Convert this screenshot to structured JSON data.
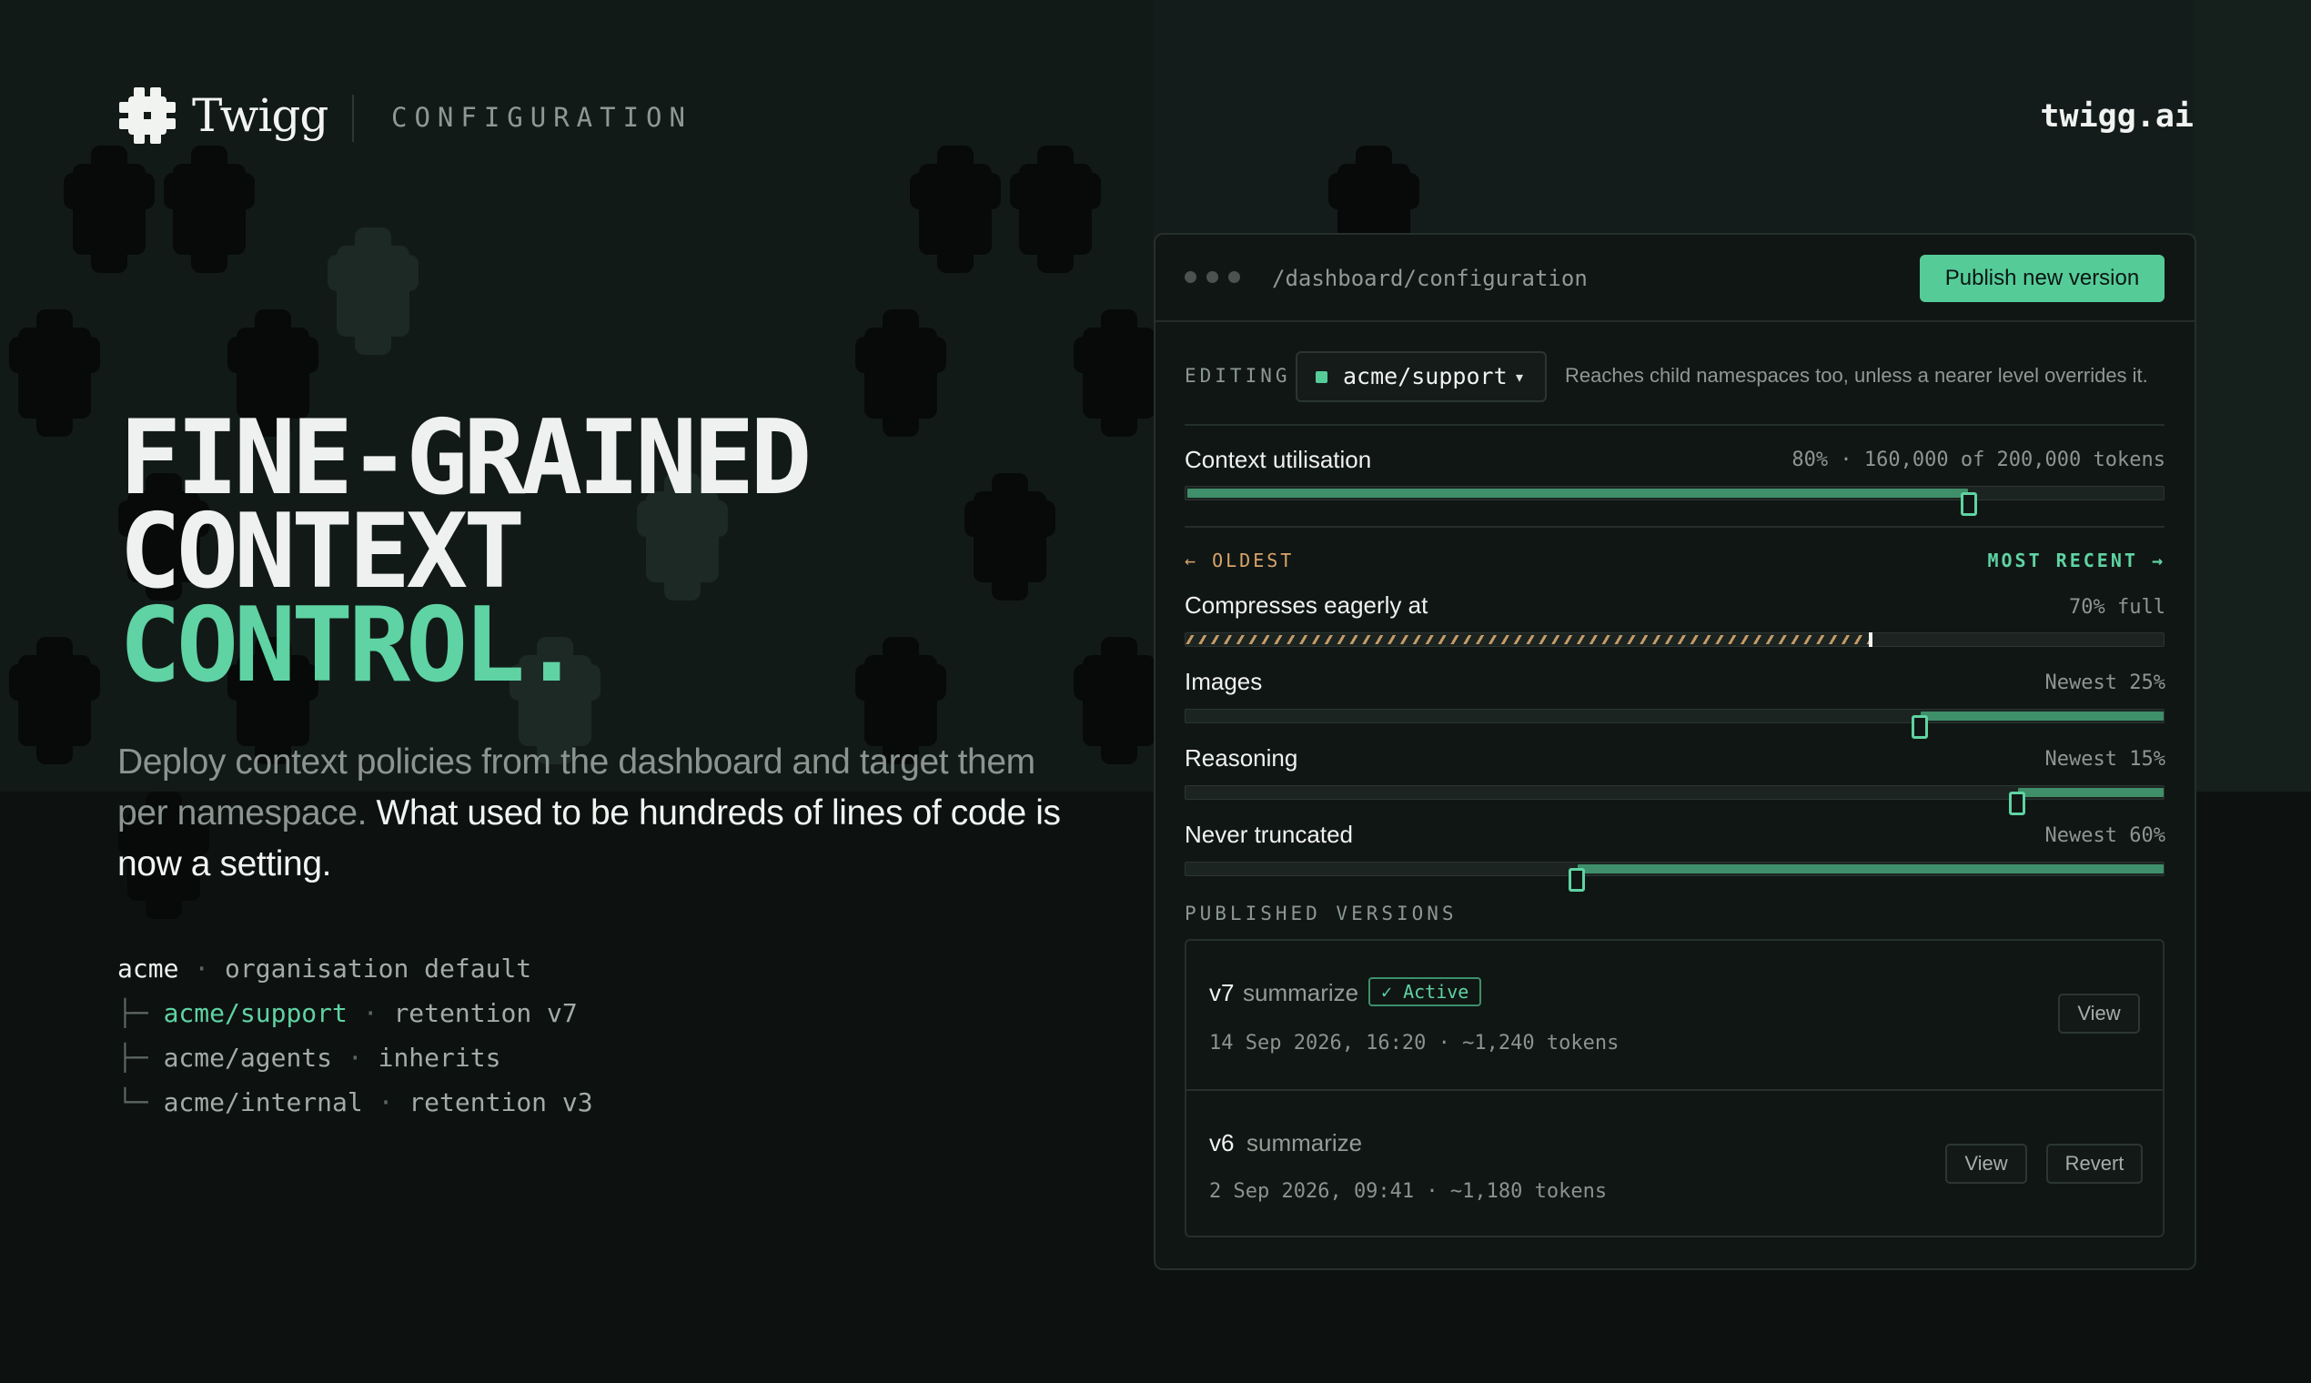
{
  "brand": {
    "name": "Twigg",
    "section": "CONFIGURATION",
    "domain": "twigg.ai"
  },
  "hero": {
    "line1": "FINE-GRAINED",
    "line2": "CONTEXT",
    "line3": "CONTROL.",
    "sub_muted": "Deploy context policies from the dashboard and target them per namespace.",
    "sub_strong": "What used to be hundreds of lines of code is now a setting."
  },
  "tree": [
    {
      "prefix": "",
      "name": "acme",
      "sep": " · ",
      "note": "organisation default"
    },
    {
      "prefix": "├─ ",
      "name": "acme/support",
      "sep": " · ",
      "note": "retention v7"
    },
    {
      "prefix": "├─ ",
      "name": "acme/agents",
      "sep": " · ",
      "note": "inherits"
    },
    {
      "prefix": "└─ ",
      "name": "acme/internal",
      "sep": " · ",
      "note": "retention v3"
    }
  ],
  "window": {
    "path": "/dashboard/configuration",
    "publish_label": "Publish new version",
    "editing_label": "EDITING",
    "namespace": "acme/support",
    "caret": "▾",
    "namespace_hint": "Reaches child namespaces too, unless a nearer level overrides it.",
    "context": {
      "label": "Context utilisation",
      "value_text": "80% · 160,000 of 200,000 tokens",
      "fraction": 0.8
    },
    "oldest_label": "← OLDEST",
    "recent_label": "MOST RECENT →",
    "compress": {
      "label": "Compresses eagerly at",
      "value_text": "70% full",
      "fraction": 0.7
    },
    "sliders": [
      {
        "label": "Images",
        "value_text": "Newest 25%",
        "fraction": 0.25
      },
      {
        "label": "Reasoning",
        "value_text": "Newest 15%",
        "fraction": 0.15
      },
      {
        "label": "Never truncated",
        "value_text": "Newest 60%",
        "fraction": 0.6
      }
    ],
    "versions_label": "PUBLISHED VERSIONS",
    "versions": [
      {
        "num": "v7",
        "name": "summarize",
        "badge": "✓ Active",
        "meta": "14 Sep 2026, 16:20 · ~1,240 tokens",
        "view": "View",
        "revert": ""
      },
      {
        "num": "v6",
        "name": "summarize",
        "badge": "",
        "meta": "2 Sep 2026, 09:41 · ~1,180 tokens",
        "view": "View",
        "revert": "Revert"
      }
    ]
  },
  "colors": {
    "accent": "#5fd3a3",
    "button": "#55cc98",
    "warm": "#d9a46a",
    "background": "#0d1110"
  }
}
